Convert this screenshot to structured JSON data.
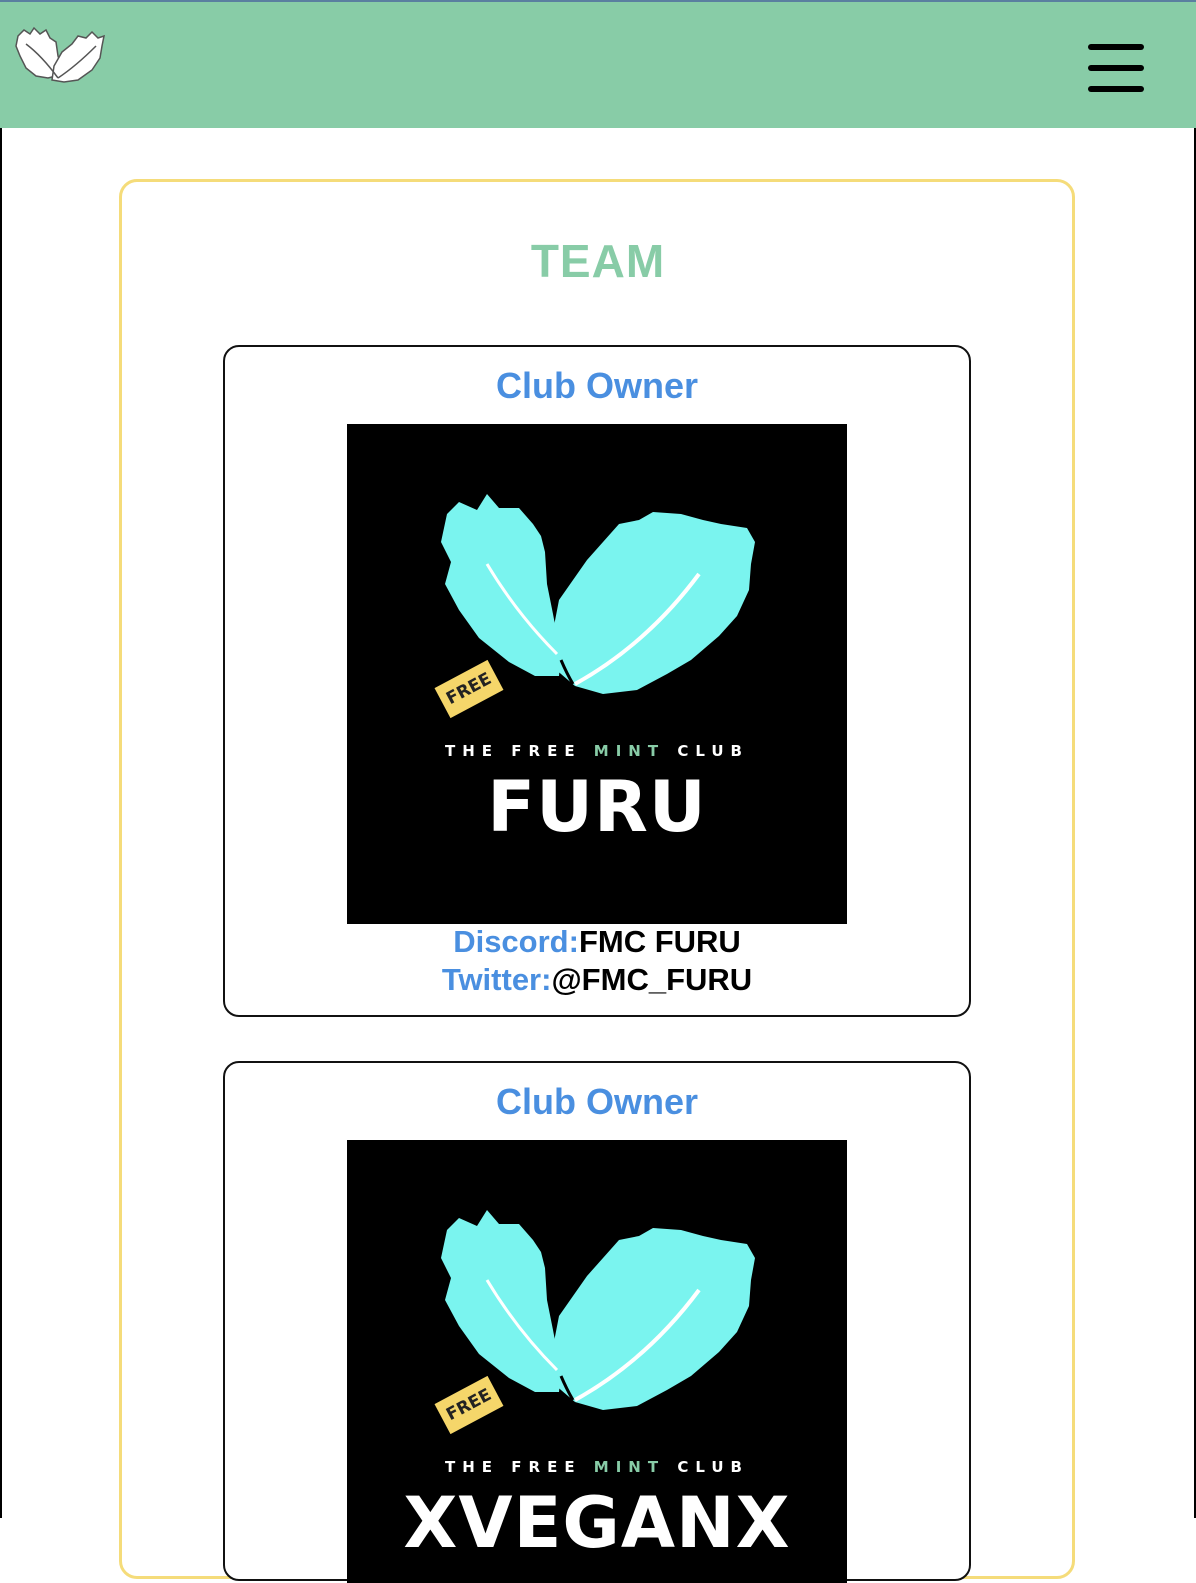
{
  "header": {
    "logo_icon": "mint-leaves-icon",
    "menu_icon": "hamburger-menu-icon",
    "background": "#88cca7"
  },
  "team": {
    "title": "TEAM",
    "accent": "#88cca7",
    "panel_border": "#f5dc7a",
    "members": [
      {
        "role": "Club Owner",
        "brand_prefix": "THE FREE ",
        "brand_mint": "MINT",
        "brand_suffix": " CLUB",
        "tag": "FREE",
        "handle": "FURU",
        "discord_label": "Discord:",
        "discord_value": "FMC FURU",
        "twitter_label": "Twitter:",
        "twitter_value": "@FMC_FURU"
      },
      {
        "role": "Club Owner",
        "brand_prefix": "THE FREE ",
        "brand_mint": "MINT",
        "brand_suffix": " CLUB",
        "tag": "FREE",
        "handle": "XVEGANX"
      }
    ]
  },
  "colors": {
    "label_blue": "#4a8fe0",
    "leaf_cyan": "#7af4ef"
  }
}
